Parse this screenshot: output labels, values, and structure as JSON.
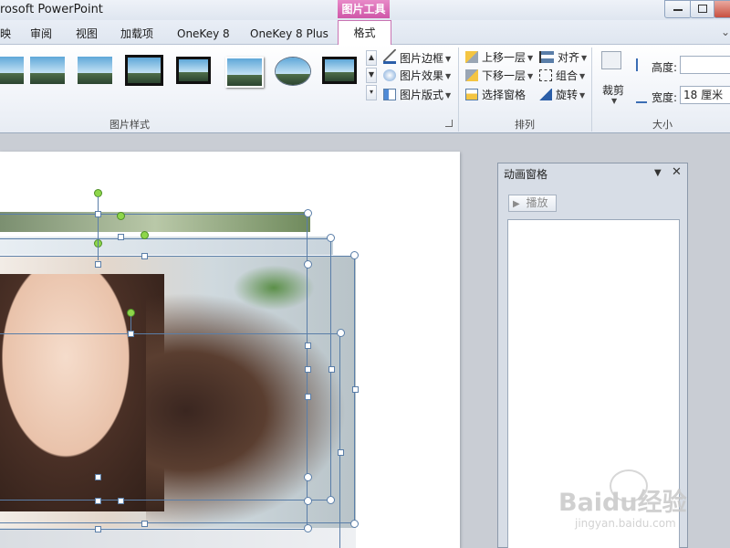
{
  "window": {
    "title": "rosoft PowerPoint",
    "contextual_tab": "图片工具"
  },
  "tabs": [
    "映",
    "审阅",
    "视图",
    "加载项",
    "OneKey 8",
    "OneKey 8 Plus",
    "格式"
  ],
  "ribbon": {
    "picture_styles": {
      "label": "图片样式",
      "commands": [
        {
          "label": "图片边框",
          "icon": "picture-border-icon"
        },
        {
          "label": "图片效果",
          "icon": "picture-effects-icon"
        },
        {
          "label": "图片版式",
          "icon": "picture-layout-icon"
        }
      ]
    },
    "arrange": {
      "label": "排列",
      "commands": [
        {
          "label": "上移一层",
          "icon": "bring-forward-icon"
        },
        {
          "label": "下移一层",
          "icon": "send-backward-icon"
        },
        {
          "label": "选择窗格",
          "icon": "selection-pane-icon"
        },
        {
          "label": "对齐",
          "icon": "align-icon"
        },
        {
          "label": "组合",
          "icon": "group-icon"
        },
        {
          "label": "旋转",
          "icon": "rotate-icon"
        }
      ]
    },
    "size": {
      "label": "大小",
      "crop_label": "裁剪",
      "height_label": "高度:",
      "height_value": "",
      "width_label": "宽度:",
      "width_value": "18 厘米"
    }
  },
  "animation_pane": {
    "title": "动画窗格",
    "play_label": "播放"
  },
  "watermark": {
    "logo": "Baidu经验",
    "url": "jingyan.baidu.com"
  },
  "colors": {
    "accent": "#c4509f",
    "ribbon_bg": "#f1f4f9",
    "pane_bg": "#d7dde6",
    "selection": "#5a7ea8",
    "rotate_handle": "#8ed64a"
  }
}
